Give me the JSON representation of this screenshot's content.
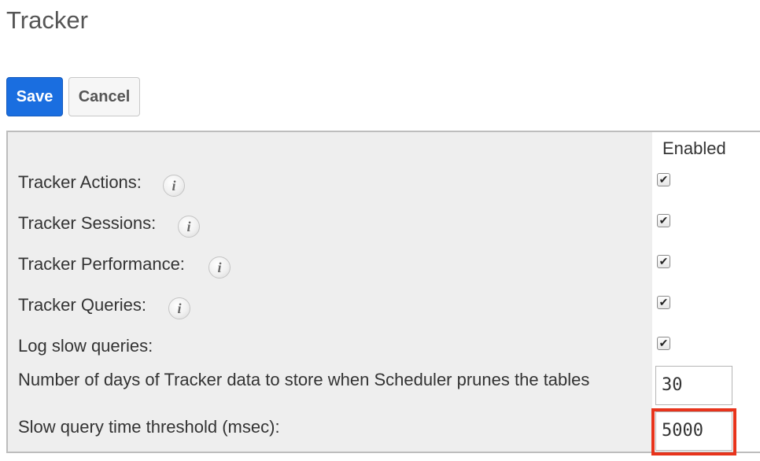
{
  "page": {
    "title": "Tracker"
  },
  "toolbar": {
    "save_label": "Save",
    "cancel_label": "Cancel"
  },
  "panel": {
    "enabled_header": "Enabled",
    "rows": [
      {
        "label": "Tracker Actions:",
        "has_info": true,
        "checked": true
      },
      {
        "label": "Tracker Sessions:",
        "has_info": true,
        "checked": true
      },
      {
        "label": "Tracker Performance:",
        "has_info": true,
        "checked": true
      },
      {
        "label": "Tracker Queries:",
        "has_info": true,
        "checked": true
      },
      {
        "label": "Log slow queries:",
        "has_info": false,
        "checked": true
      }
    ],
    "prune_days": {
      "label": "Number of days of Tracker data to store when Scheduler prunes the tables",
      "value": "30"
    },
    "slow_query_threshold": {
      "label": "Slow query time threshold (msec):",
      "value": "5000"
    }
  },
  "icons": {
    "info": "info-icon",
    "check": "checkmark-icon"
  },
  "colors": {
    "save_button": "#1a6ee0",
    "highlight_border": "#e8341c",
    "panel_bg": "#eeeeee"
  }
}
